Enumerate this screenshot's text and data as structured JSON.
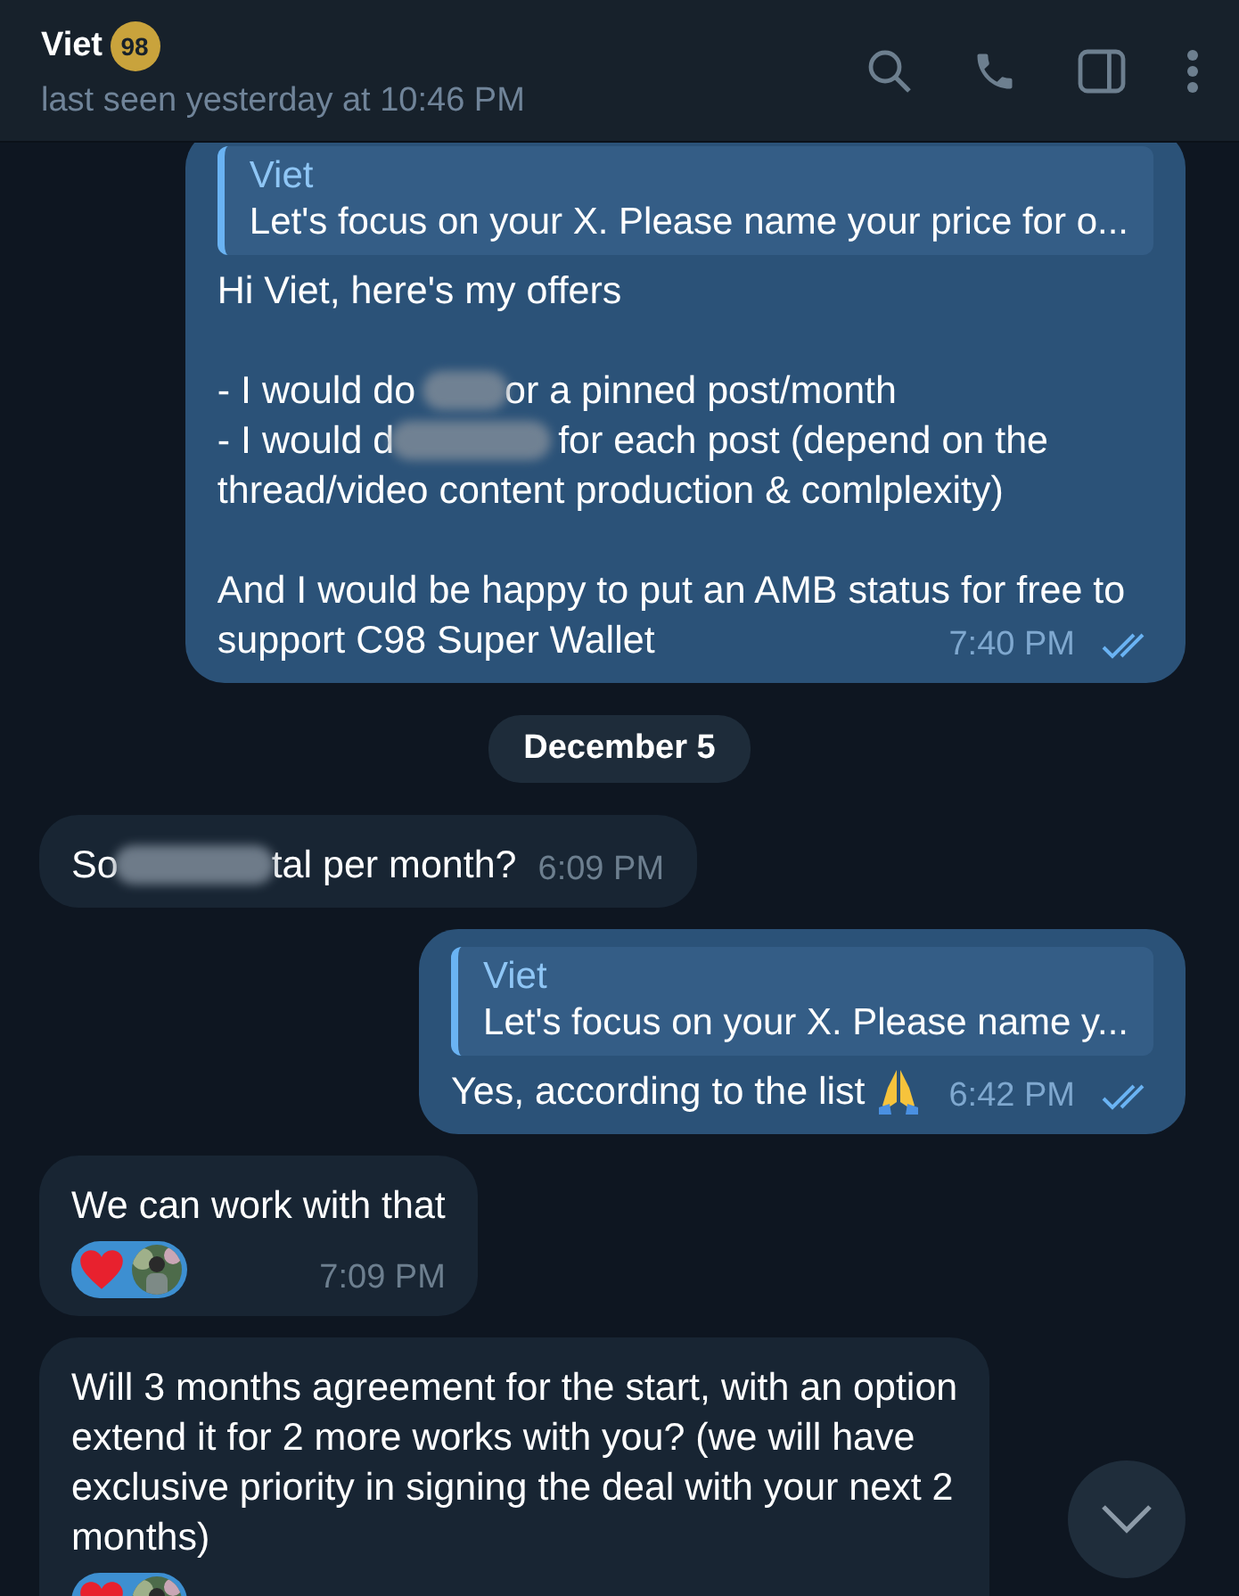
{
  "header": {
    "name": "Viet",
    "badge": "98",
    "status": "last seen yesterday at 10:46 PM"
  },
  "messages": [
    {
      "kind": "outgoing",
      "reply": {
        "author": "Viet",
        "text": "Let's focus on your X. Please name your price for o..."
      },
      "paragraphs": [
        [
          [
            {
              "kind": "text",
              "text": "Hi Viet, here's my offers"
            }
          ]
        ],
        [
          [
            {
              "kind": "text",
              "text": "- I would do "
            },
            {
              "kind": "blur_short"
            },
            {
              "kind": "text",
              "text": "or a pinned post/month"
            }
          ],
          [
            {
              "kind": "text",
              "text": "- I would d"
            },
            {
              "kind": "blur_long"
            },
            {
              "kind": "text",
              "text": " for each post (depend on the"
            }
          ],
          [
            {
              "kind": "text",
              "text": "thread/video content production & comlplexity)"
            }
          ]
        ],
        [
          [
            {
              "kind": "text",
              "text": "And I would be happy to put an AMB status for free to"
            }
          ],
          [
            {
              "kind": "text",
              "text": "support C98 Super Wallet"
            }
          ]
        ]
      ],
      "time": "7:40 PM",
      "read": true
    },
    {
      "kind": "date",
      "text": "December 5"
    },
    {
      "kind": "incoming",
      "paragraphs": [
        [
          [
            {
              "kind": "text",
              "text": "So"
            },
            {
              "kind": "blur_long"
            },
            {
              "kind": "text",
              "text": "tal per month?"
            }
          ]
        ]
      ],
      "time": "6:09 PM"
    },
    {
      "kind": "outgoing",
      "reply": {
        "author": "Viet",
        "text": "Let's focus on your X. Please name y..."
      },
      "paragraphs": [
        [
          [
            {
              "kind": "text",
              "text": "Yes, according to the list "
            },
            {
              "kind": "pray_emoji"
            }
          ]
        ]
      ],
      "time": "6:42 PM",
      "read": true
    },
    {
      "kind": "incoming",
      "paragraphs": [
        [
          [
            {
              "kind": "text",
              "text": "We can work with that"
            }
          ]
        ]
      ],
      "reaction": {
        "kind": "heart"
      },
      "time": "7:09 PM"
    },
    {
      "kind": "incoming",
      "paragraphs": [
        [
          [
            {
              "kind": "text",
              "text": "Will 3 months agreement for the start, with an option"
            }
          ],
          [
            {
              "kind": "text",
              "text": "extend it for 2 more works with you? (we will have"
            }
          ],
          [
            {
              "kind": "text",
              "text": "exclusive priority in signing the deal with your next 2"
            }
          ],
          [
            {
              "kind": "text",
              "text": "months)"
            }
          ]
        ]
      ],
      "reaction": {
        "kind": "heart"
      }
    }
  ]
}
